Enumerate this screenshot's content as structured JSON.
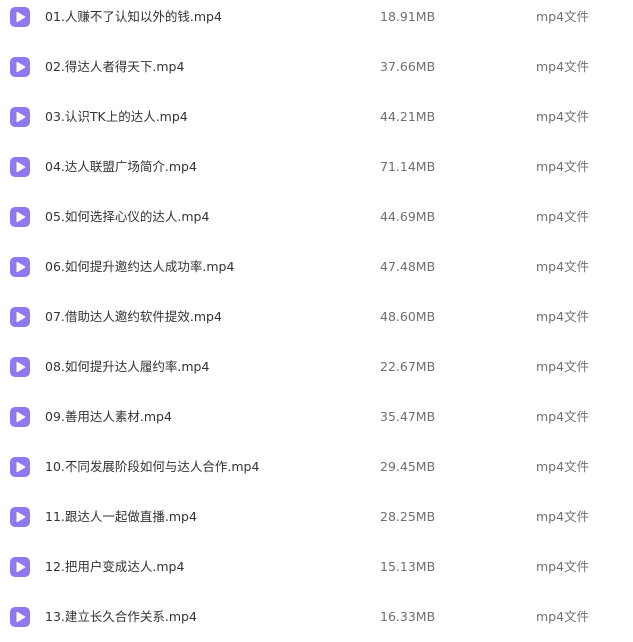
{
  "files": [
    {
      "name": "01.人赚不了认知以外的钱.mp4",
      "size": "18.91MB",
      "type": "mp4文件",
      "icon": "video-file-icon"
    },
    {
      "name": "02.得达人者得天下.mp4",
      "size": "37.66MB",
      "type": "mp4文件",
      "icon": "video-file-icon"
    },
    {
      "name": "03.认识TK上的达人.mp4",
      "size": "44.21MB",
      "type": "mp4文件",
      "icon": "video-file-icon"
    },
    {
      "name": "04.达人联盟广场简介.mp4",
      "size": "71.14MB",
      "type": "mp4文件",
      "icon": "video-file-icon"
    },
    {
      "name": "05.如何选择心仪的达人.mp4",
      "size": "44.69MB",
      "type": "mp4文件",
      "icon": "video-file-icon"
    },
    {
      "name": "06.如何提升邀约达人成功率.mp4",
      "size": "47.48MB",
      "type": "mp4文件",
      "icon": "video-file-icon"
    },
    {
      "name": "07.借助达人邀约软件提效.mp4",
      "size": "48.60MB",
      "type": "mp4文件",
      "icon": "video-file-icon"
    },
    {
      "name": "08.如何提升达人履约率.mp4",
      "size": "22.67MB",
      "type": "mp4文件",
      "icon": "video-file-icon"
    },
    {
      "name": "09.善用达人素材.mp4",
      "size": "35.47MB",
      "type": "mp4文件",
      "icon": "video-file-icon"
    },
    {
      "name": "10.不同发展阶段如何与达人合作.mp4",
      "size": "29.45MB",
      "type": "mp4文件",
      "icon": "video-file-icon"
    },
    {
      "name": "11.跟达人一起做直播.mp4",
      "size": "28.25MB",
      "type": "mp4文件",
      "icon": "video-file-icon"
    },
    {
      "name": "12.把用户变成达人.mp4",
      "size": "15.13MB",
      "type": "mp4文件",
      "icon": "video-file-icon"
    },
    {
      "name": "13.建立长久合作关系.mp4",
      "size": "16.33MB",
      "type": "mp4文件",
      "icon": "video-file-icon"
    }
  ],
  "colors": {
    "icon_background": "#9078f0",
    "icon_glyph": "#ffffff",
    "name_text": "#333333",
    "meta_text": "#6f6f6f"
  }
}
